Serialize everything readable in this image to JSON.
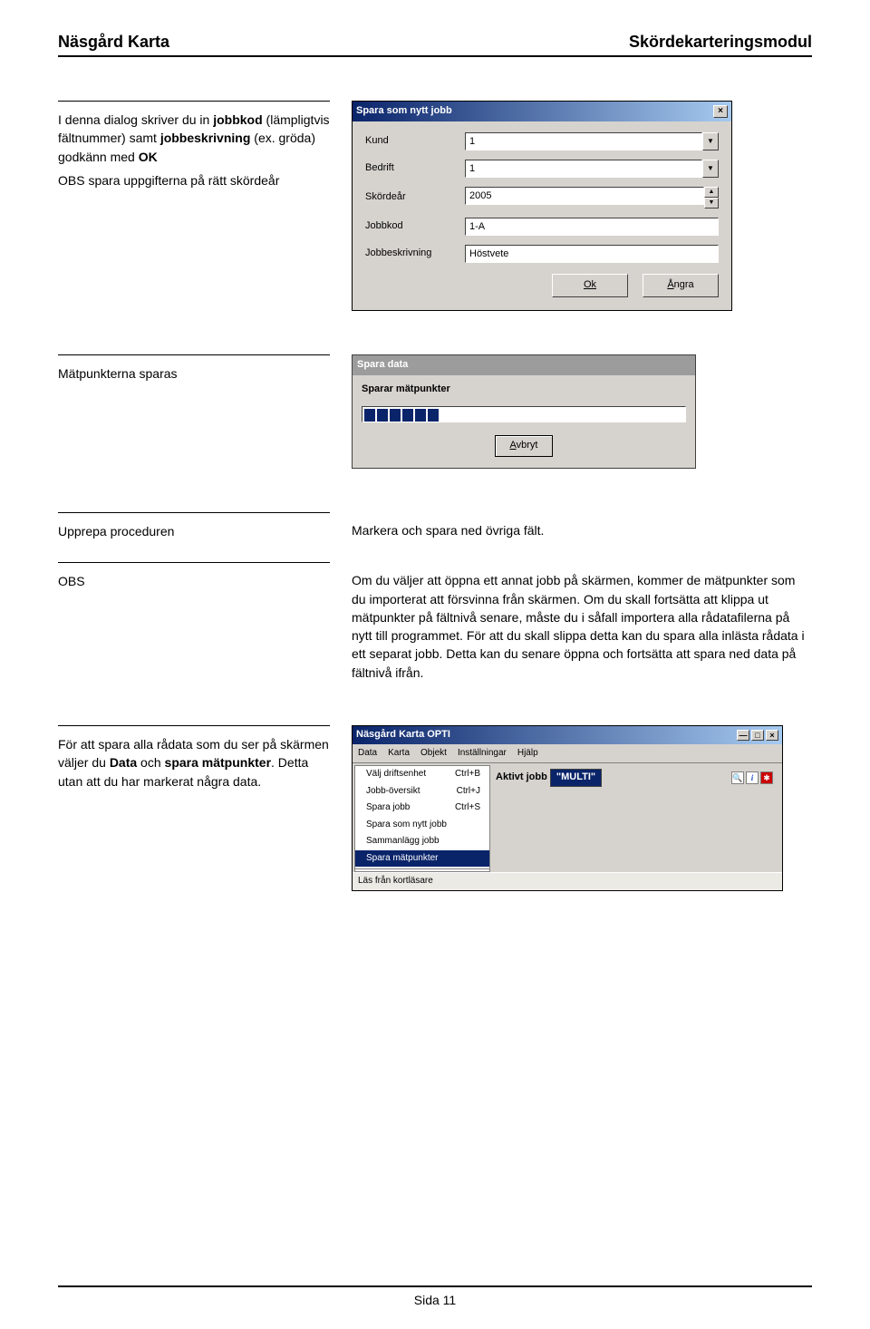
{
  "header": {
    "left": "Näsgård Karta",
    "right": "Skördekarteringsmodul"
  },
  "sec1": {
    "left": {
      "p1_a": "I denna dialog skriver du in ",
      "p1_b": "jobbkod",
      "p1_c": " (lämpligtvis fältnummer) samt ",
      "p1_d": "jobbeskrivning",
      "p1_e": " (ex. gröda) godkänn med ",
      "p1_f": "OK",
      "p2": "OBS spara uppgifterna på rätt skördeår"
    },
    "dialog": {
      "title": "Spara som nytt jobb",
      "fields": [
        {
          "label": "Kund",
          "value": "1",
          "type": "combo"
        },
        {
          "label": "Bedrift",
          "value": "1",
          "type": "combo"
        },
        {
          "label": "Skördeår",
          "value": "2005",
          "type": "spinner"
        },
        {
          "label": "Jobbkod",
          "value": "1-A",
          "type": "text"
        },
        {
          "label": "Jobbeskrivning",
          "value": "Höstvete",
          "type": "text"
        }
      ],
      "ok": "Ok",
      "cancel_u": "Å",
      "cancel_rest": "ngra"
    }
  },
  "sec2": {
    "left": "Mätpunkterna sparas",
    "progress": {
      "title": "Spara data",
      "label": "Sparar mätpunkter",
      "btn_u": "A",
      "btn_rest": "vbryt"
    }
  },
  "sec3": {
    "left1": "Upprepa proceduren",
    "right1": "Markera och spara ned övriga fält.",
    "left2": "OBS",
    "right2": "Om du väljer att öppna ett annat jobb på skärmen, kommer de mätpunkter som du importerat att försvinna från skärmen. Om du skall fortsätta att klippa ut mätpunkter på fältnivå senare, måste du i såfall importera alla rådatafilerna på nytt till programmet. För att du skall slippa detta kan du spara alla inlästa rådata i ett separat jobb. Detta kan du senare öppna och fortsätta att spara ned data på fältnivå ifrån."
  },
  "sec4": {
    "left_a": "För att spara alla rådata som du ser på skärmen väljer du ",
    "left_b": "Data",
    "left_c": " och ",
    "left_d": "spara mätpunkter",
    "left_e": ". Detta utan att du har markerat några data.",
    "app": {
      "title": "Näsgård Karta OPTI",
      "menus": [
        "Data",
        "Karta",
        "Objekt",
        "Inställningar",
        "Hjälp"
      ],
      "dropdown": [
        {
          "label": "Välj driftsenhet",
          "acc": "Ctrl+B"
        },
        {
          "label": "Jobb-översikt",
          "acc": "Ctrl+J"
        },
        {
          "label": "Spara jobb",
          "acc": "Ctrl+S"
        },
        {
          "label": "Spara som nytt jobb",
          "acc": ""
        },
        {
          "label": "Sammanlägg jobb",
          "acc": ""
        },
        {
          "label": "Spara mätpunkter",
          "acc": "",
          "selected": true
        }
      ],
      "jobb_label": "Aktivt jobb",
      "jobb_value": "\"MULTI\"",
      "lowband": "Läs från kortläsare"
    }
  },
  "footer": "Sida 11"
}
